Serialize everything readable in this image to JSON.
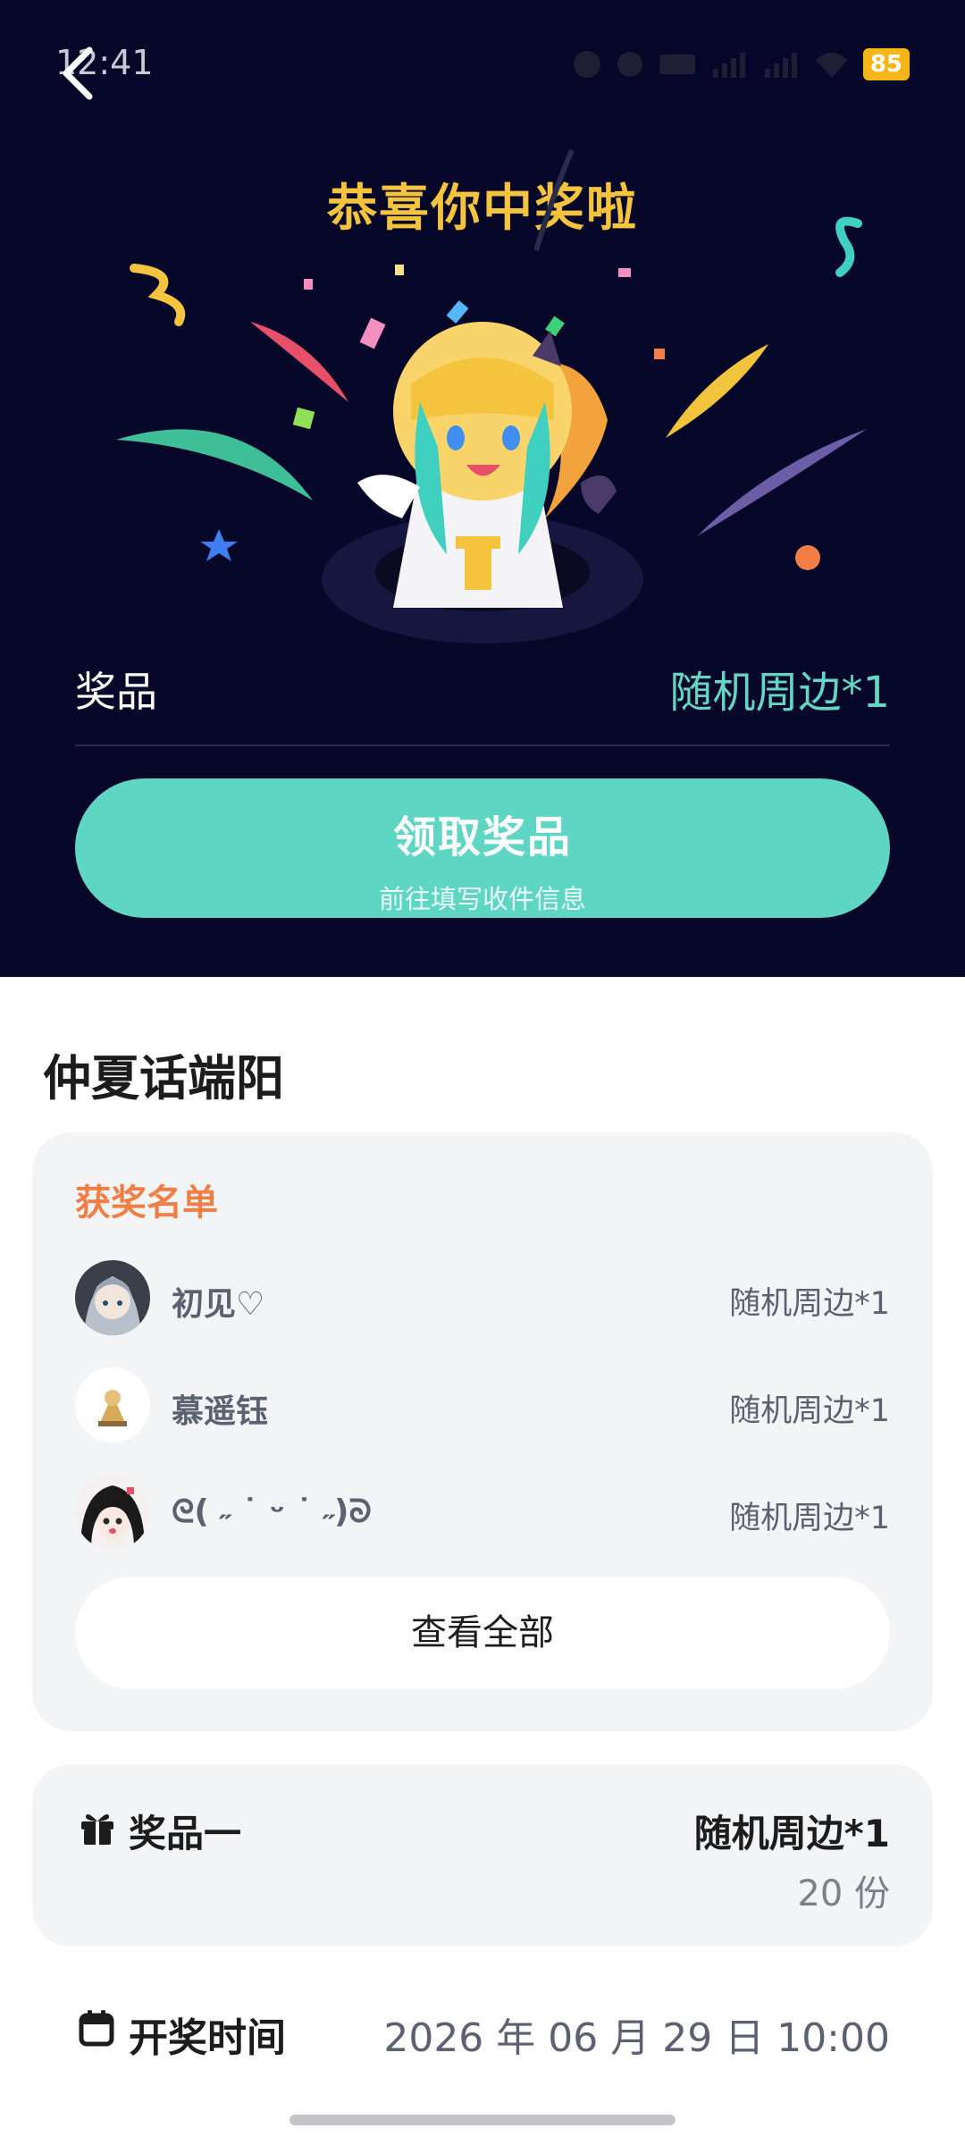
{
  "status_bar": {
    "time": "12:41",
    "battery": "85"
  },
  "hero": {
    "title": "恭喜你中奖啦",
    "prize_label": "奖品",
    "prize_value": "随机周边*1",
    "claim_button": {
      "label": "领取奖品",
      "sublabel": "前往填写收件信息"
    }
  },
  "activity": {
    "title": "仲夏话端阳"
  },
  "winners": {
    "title": "获奖名单",
    "items": [
      {
        "name": "初见♡",
        "prize": "随机周边*1"
      },
      {
        "name": "慕遥钰",
        "prize": "随机周边*1"
      },
      {
        "name": "ᘓ( ˶ ˙ ᵕ ˙ ˶)ᘐ",
        "prize": "随机周边*1"
      }
    ],
    "view_all": "查看全部"
  },
  "prize_info": {
    "label": "奖品一",
    "value": "随机周边*1",
    "count": "20 份"
  },
  "draw_time": {
    "label": "开奖时间",
    "value": "2026 年 06 月 29 日 10:00"
  },
  "colors": {
    "hero_bg": "#07072a",
    "accent": "#5fd6c3",
    "title_gold": "#f5c43f",
    "winners_orange": "#f07e45"
  }
}
